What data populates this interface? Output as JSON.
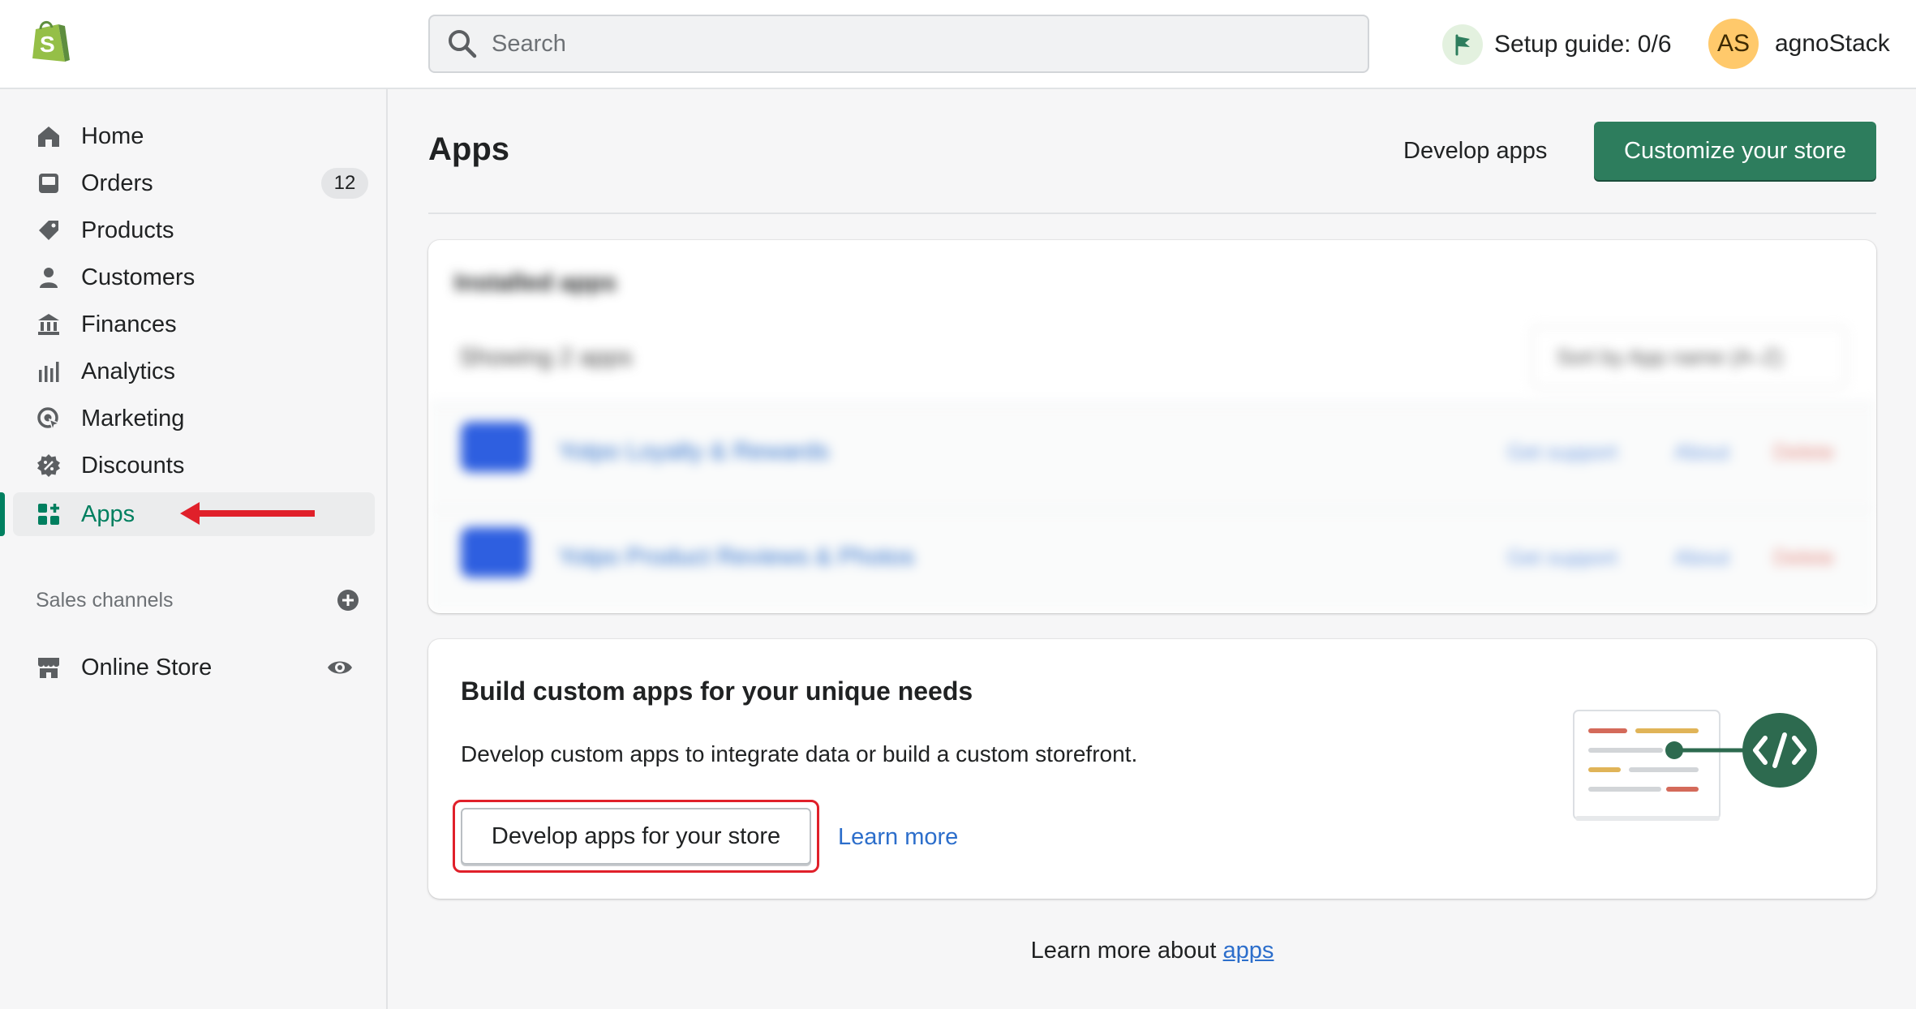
{
  "topbar": {
    "search_placeholder": "Search",
    "setup_guide": "Setup guide: 0/6",
    "avatar_initials": "AS",
    "store_name": "agnoStack"
  },
  "sidebar": {
    "items": [
      {
        "label": "Home",
        "icon": "home-icon"
      },
      {
        "label": "Orders",
        "icon": "orders-icon",
        "badge": "12"
      },
      {
        "label": "Products",
        "icon": "tag-icon"
      },
      {
        "label": "Customers",
        "icon": "person-icon"
      },
      {
        "label": "Finances",
        "icon": "bank-icon"
      },
      {
        "label": "Analytics",
        "icon": "bar-chart-icon"
      },
      {
        "label": "Marketing",
        "icon": "target-icon"
      },
      {
        "label": "Discounts",
        "icon": "discount-icon"
      },
      {
        "label": "Apps",
        "icon": "apps-icon",
        "active": true
      }
    ],
    "sales_channels_label": "Sales channels",
    "online_store_label": "Online Store"
  },
  "main": {
    "title": "Apps",
    "develop_apps_label": "Develop apps",
    "customize_label": "Customize your store",
    "installed": {
      "title": "Installed apps",
      "count": "Showing 2 apps",
      "sort": "Sort by  App name (A–Z)",
      "apps": [
        {
          "name": "Yotpo Loyalty & Rewards",
          "support": "Get support",
          "about": "About",
          "delete": "Delete"
        },
        {
          "name": "Yotpo Product Reviews & Photos",
          "support": "Get support",
          "about": "About",
          "delete": "Delete"
        }
      ]
    },
    "build": {
      "heading": "Build custom apps for your unique needs",
      "description": "Develop custom apps to integrate data or build a custom storefront.",
      "button_label": "Develop apps for your store",
      "learn_more": "Learn more"
    },
    "footer_prefix": "Learn more about ",
    "footer_link": "apps"
  },
  "colors": {
    "brand_green": "#008060",
    "primary_button": "#2d7d5d",
    "link_blue": "#2c6ecb",
    "highlight_red": "#e0202a",
    "avatar_bg": "#ffc96b"
  }
}
